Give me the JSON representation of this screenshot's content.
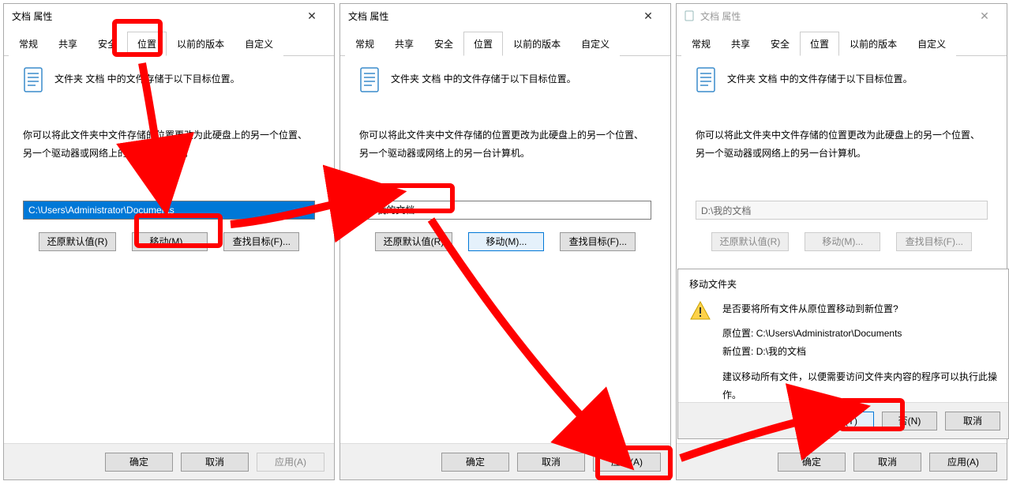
{
  "dialogs": [
    {
      "title": "文档 属性",
      "tabs": [
        "常规",
        "共享",
        "安全",
        "位置",
        "以前的版本",
        "自定义"
      ],
      "activeTab": 3,
      "descText": "文件夹 文档 中的文件存储于以下目标位置。",
      "para": "你可以将此文件夹中文件存储的位置更改为此硬盘上的另一个位置、另一个驱动器或网络上的另一台计算机。",
      "pathValue": "C:\\Users\\Administrator\\Documents",
      "btns": {
        "restore": "还原默认值(R)",
        "move": "移动(M)...",
        "find": "查找目标(F)..."
      },
      "footer": {
        "ok": "确定",
        "cancel": "取消",
        "apply": "应用(A)"
      },
      "applyDisabled": true
    },
    {
      "title": "文档 属性",
      "tabs": [
        "常规",
        "共享",
        "安全",
        "位置",
        "以前的版本",
        "自定义"
      ],
      "activeTab": 3,
      "descText": "文件夹 文档 中的文件存储于以下目标位置。",
      "para": "你可以将此文件夹中文件存储的位置更改为此硬盘上的另一个位置、另一个驱动器或网络上的另一台计算机。",
      "pathValue": "D:\\我的文档",
      "btns": {
        "restore": "还原默认值(R)",
        "move": "移动(M)...",
        "find": "查找目标(F)..."
      },
      "footer": {
        "ok": "确定",
        "cancel": "取消",
        "apply": "应用(A)"
      },
      "applyDisabled": false
    },
    {
      "title": "文档 属性",
      "tabs": [
        "常规",
        "共享",
        "安全",
        "位置",
        "以前的版本",
        "自定义"
      ],
      "activeTab": 3,
      "descText": "文件夹 文档 中的文件存储于以下目标位置。",
      "para": "你可以将此文件夹中文件存储的位置更改为此硬盘上的另一个位置、另一个驱动器或网络上的另一台计算机。",
      "pathValue": "D:\\我的文档",
      "btns": {
        "restore": "还原默认值(R)",
        "move": "移动(M)...",
        "find": "查找目标(F)..."
      },
      "footer": {
        "ok": "确定",
        "cancel": "取消",
        "apply": "应用(A)"
      },
      "applyDisabled": false
    }
  ],
  "confirm": {
    "title": "移动文件夹",
    "question": "是否要将所有文件从原位置移动到新位置?",
    "oldLabel": "原位置:",
    "oldPath": "C:\\Users\\Administrator\\Documents",
    "newLabel": "新位置:",
    "newPath": "D:\\我的文档",
    "advice": "建议移动所有文件，以便需要访问文件夹内容的程序可以执行此操作。",
    "yes": "是(Y)",
    "no": "否(N)",
    "cancel": "取消"
  }
}
